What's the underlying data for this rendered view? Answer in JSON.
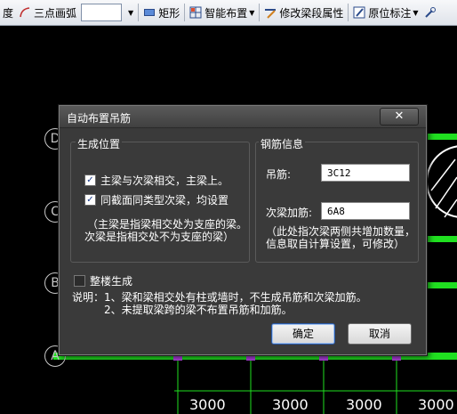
{
  "toolbar": {
    "items": [
      {
        "label": "度"
      },
      {
        "label": "三点画弧"
      },
      {
        "label": "矩形"
      },
      {
        "label": "智能布置"
      },
      {
        "label": "修改梁段属性"
      },
      {
        "label": "原位标注"
      }
    ]
  },
  "canvas": {
    "axis_labels": [
      "D",
      "C",
      "B",
      "A"
    ],
    "dimensions": [
      "3000",
      "3000",
      "3000",
      "3000"
    ]
  },
  "dialog": {
    "title": "自动布置吊筋",
    "close": "✕",
    "generate_position": {
      "title": "生成位置",
      "options": [
        {
          "label": "主梁与次梁相交，主梁上。",
          "checked": true
        },
        {
          "label": "同截面同类型次梁，均设置",
          "checked": true
        }
      ],
      "note_line1": "（主梁是指梁相交处为支座的梁。",
      "note_line2": "次梁是指相交处不为支座的梁）"
    },
    "rebar_info": {
      "title": "钢筋信息",
      "hanger_label": "吊筋:",
      "hanger_value": "3C12",
      "extra_stirrup_label": "次梁加筋:",
      "extra_stirrup_value": "6A8",
      "note_line1": "（此处指次梁两侧共增加数量，",
      "note_line2": "信息取自计算设置，可修改）"
    },
    "whole_building": {
      "label": "整楼生成",
      "checked": false
    },
    "explanation_line1": "说明：1、梁和梁相交处有柱或墙时，不生成吊筋和次梁加筋。",
    "explanation_line2": "2、未提取梁跨的梁不布置吊筋和加筋。",
    "ok": "确定",
    "cancel": "取消"
  }
}
